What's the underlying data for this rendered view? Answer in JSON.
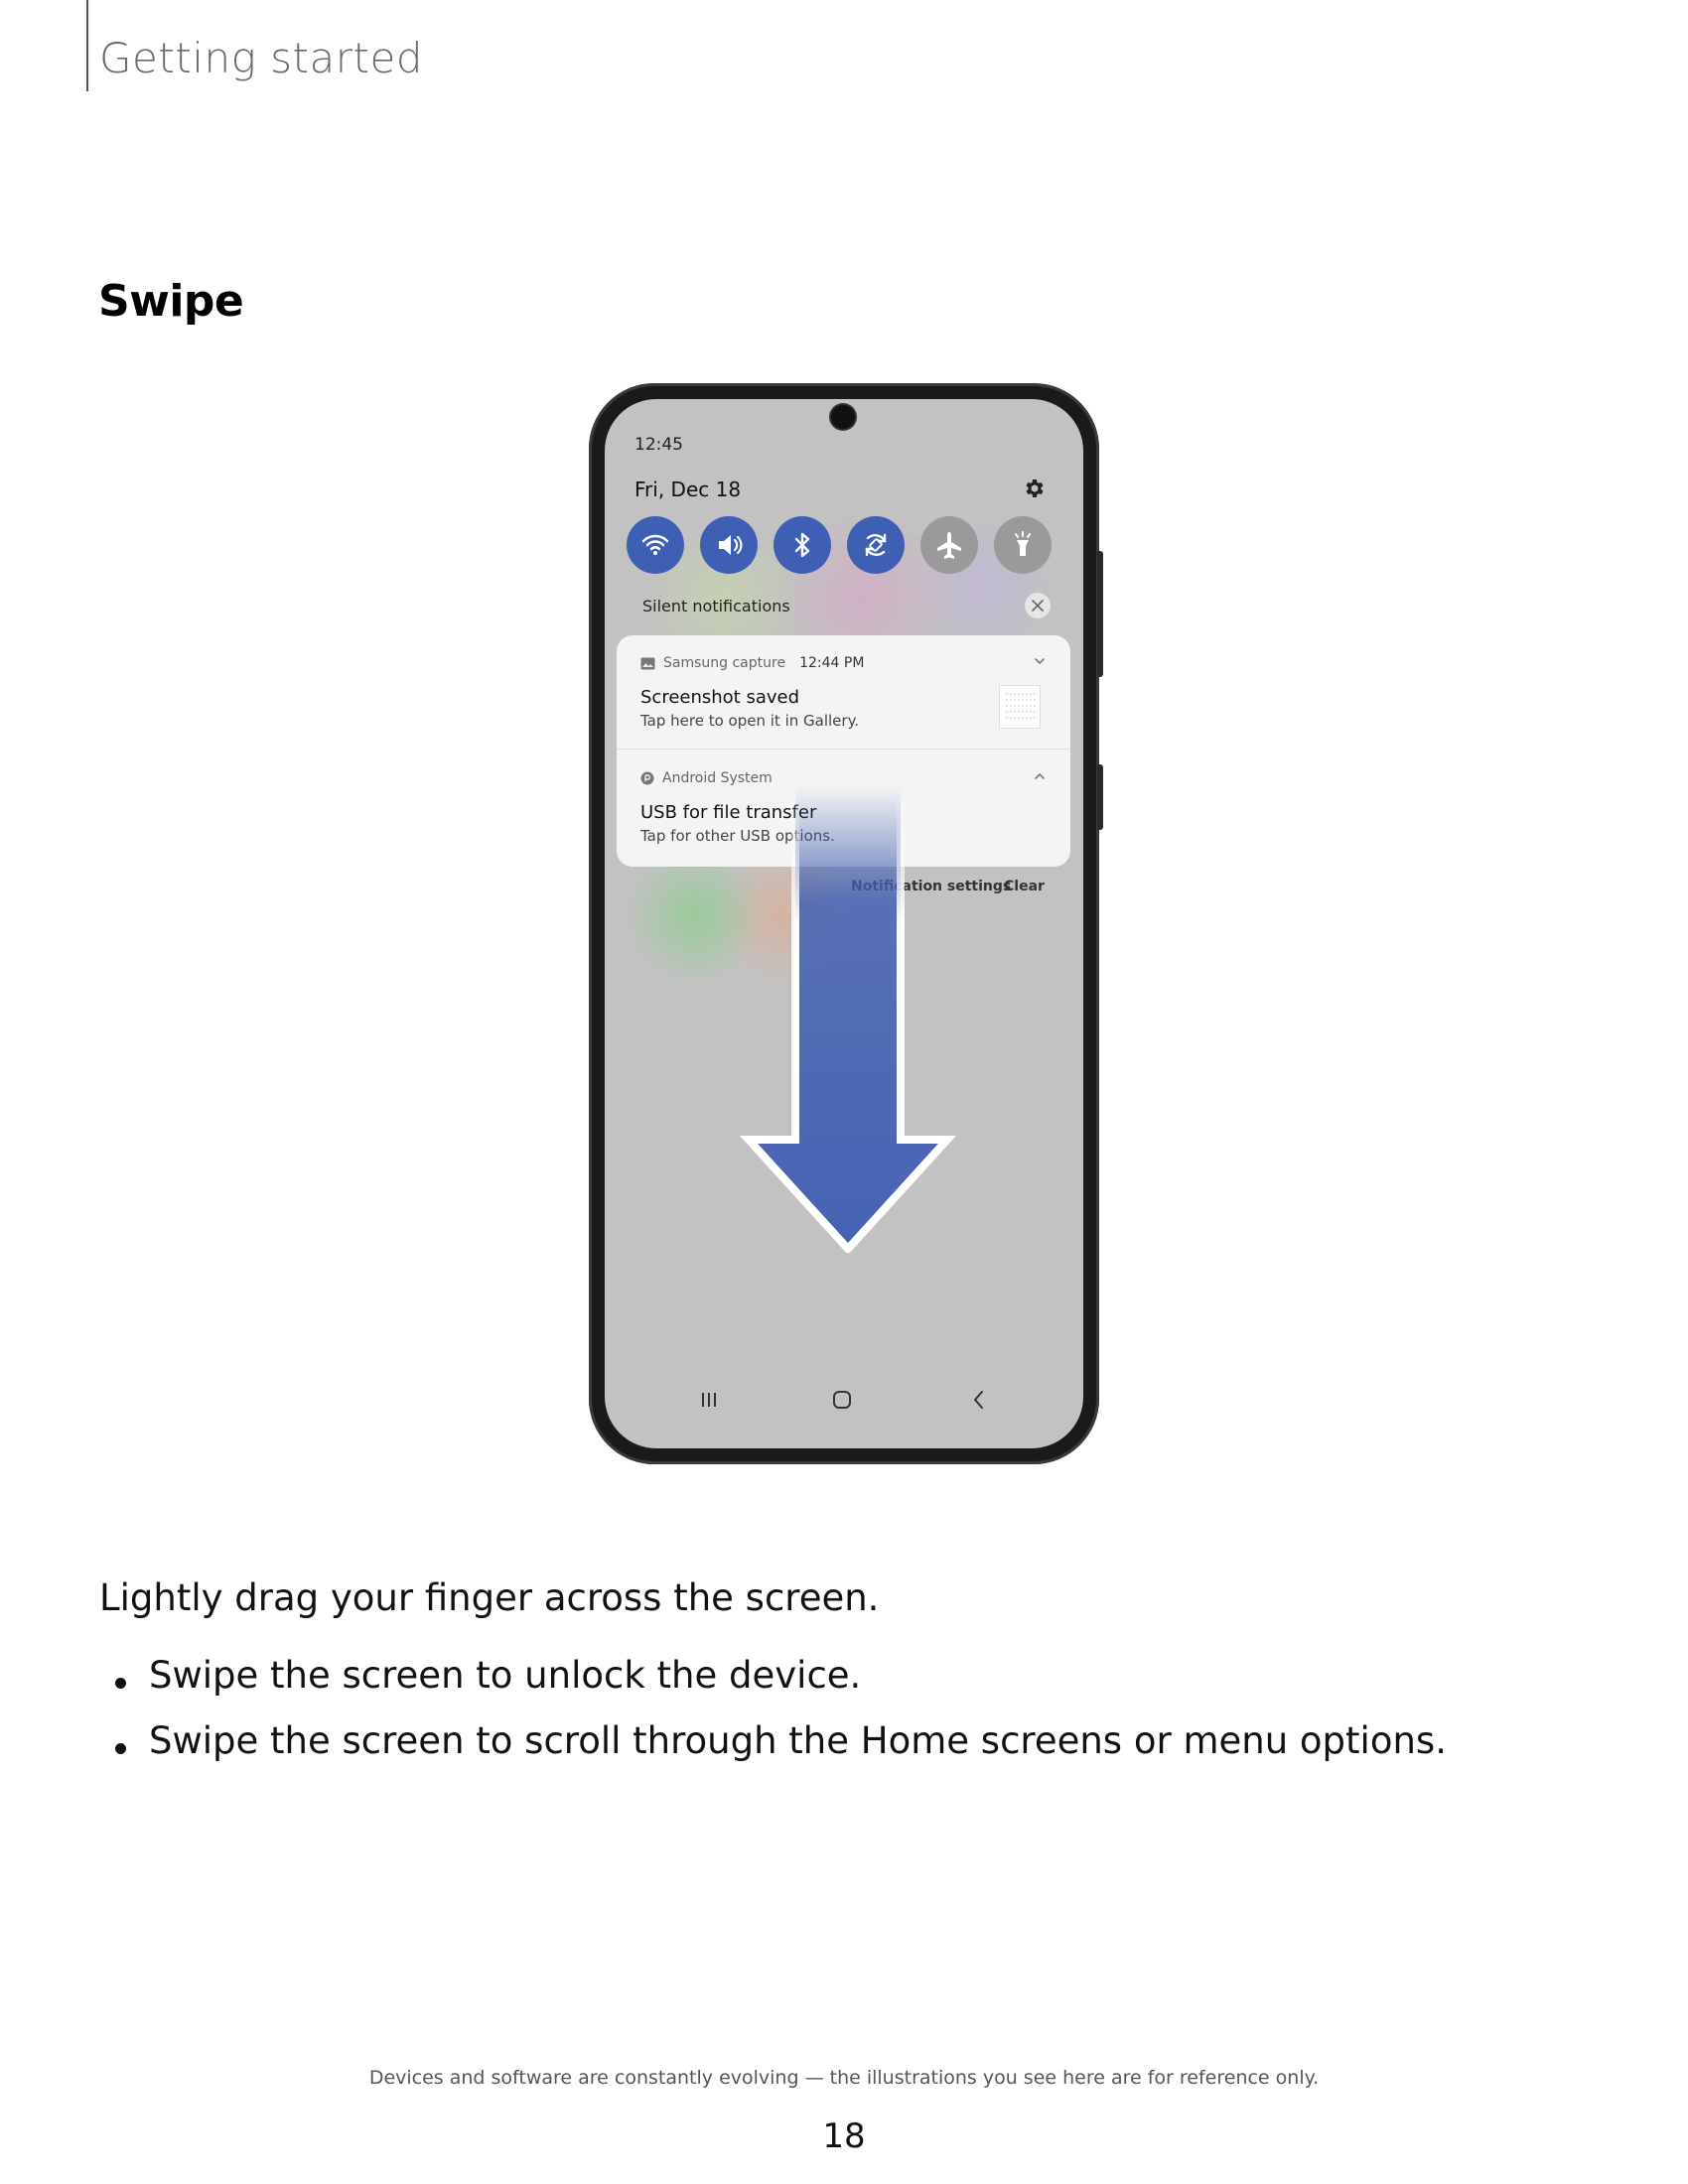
{
  "header": {
    "section": "Getting started"
  },
  "page": {
    "title": "Swipe",
    "number": "18"
  },
  "phone_screen": {
    "status_time": "12:45",
    "date": "Fri, Dec 18",
    "quick_settings": [
      {
        "icon": "wifi-icon",
        "state": "on"
      },
      {
        "icon": "sound-icon",
        "state": "on"
      },
      {
        "icon": "bluetooth-icon",
        "state": "on"
      },
      {
        "icon": "auto-rotate-icon",
        "state": "on"
      },
      {
        "icon": "airplane-mode-icon",
        "state": "off"
      },
      {
        "icon": "flashlight-icon",
        "state": "off"
      }
    ],
    "silent_label": "Silent notifications",
    "notifications": [
      {
        "app": "Samsung capture",
        "time": "12:44 PM",
        "title": "Screenshot saved",
        "text": "Tap here to open it in Gallery."
      },
      {
        "app": "Android System",
        "time": "",
        "title": "USB for file transfer",
        "text": "Tap for other USB options."
      }
    ],
    "actions": {
      "settings": "Notification settings",
      "clear": "Clear"
    },
    "accent_color": "#3f5fb4",
    "arrow_color": "#4562b3",
    "swipe_direction": "down"
  },
  "body": {
    "intro": "Lightly drag your finger across the screen.",
    "bullets": [
      "Swipe the screen to unlock the device.",
      "Swipe the screen to scroll through the Home screens or menu options."
    ]
  },
  "footer": {
    "note": "Devices and software are constantly evolving — the illustrations you see here are for reference only."
  }
}
